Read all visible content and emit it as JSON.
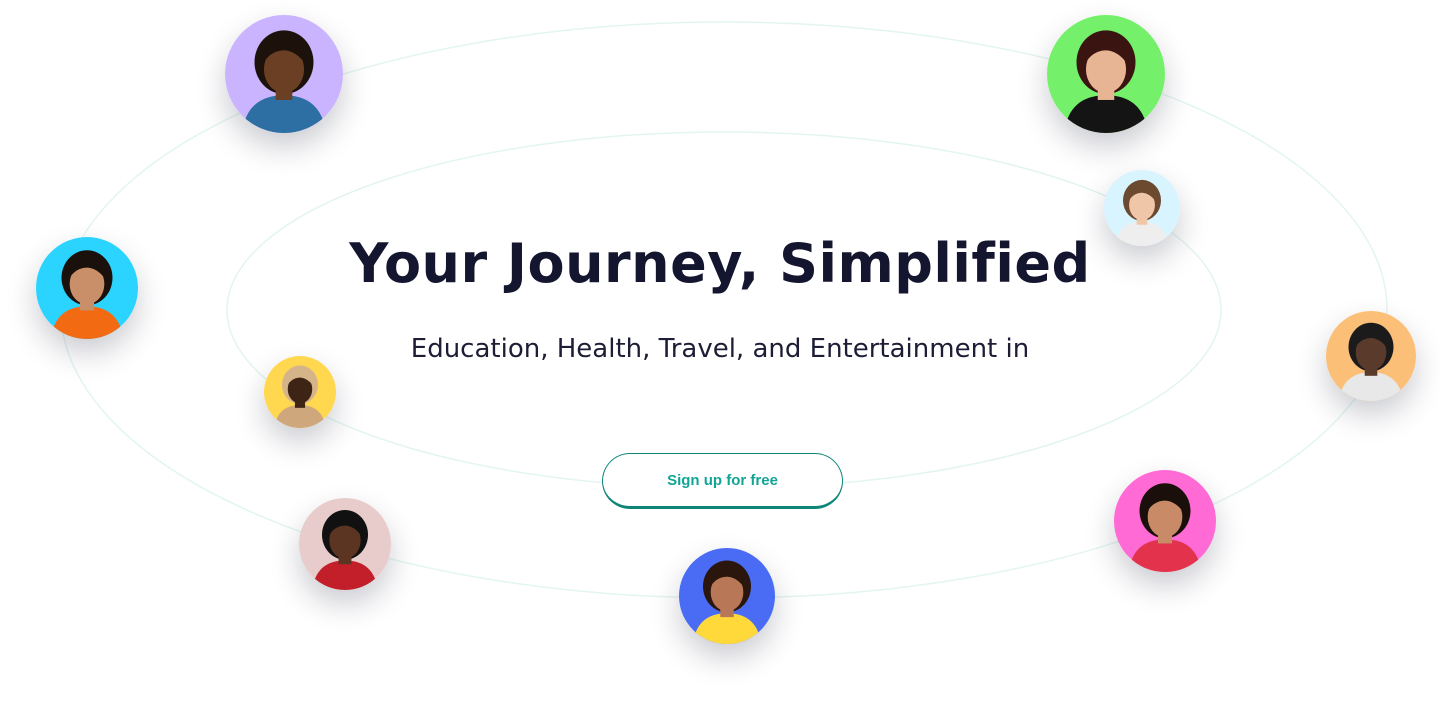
{
  "hero": {
    "title": "Your Journey, Simplified",
    "subtitle": "Education, Health, Travel, and Entertainment in",
    "cta_label": "Sign up for free"
  },
  "colors": {
    "accent_teal": "#12a596",
    "button_border": "#0f8578",
    "heading": "#14152e",
    "orbit_line": "#e3f5f1"
  },
  "avatars": [
    {
      "name": "avatar-purple",
      "bg": "#cbb4ff",
      "skin": "#6b3f24",
      "hair": "#1d120b",
      "shirt": "#2d6fa3"
    },
    {
      "name": "avatar-green",
      "bg": "#74f06a",
      "skin": "#e7b594",
      "hair": "#3a1410",
      "shirt": "#141414"
    },
    {
      "name": "avatar-light-blue",
      "bg": "#d8f4ff",
      "skin": "#efc7a8",
      "hair": "#6b4a30",
      "shirt": "#eeeeee"
    },
    {
      "name": "avatar-cyan",
      "bg": "#2ad4ff",
      "skin": "#c98f68",
      "hair": "#1a110c",
      "shirt": "#f26a12"
    },
    {
      "name": "avatar-orange",
      "bg": "#fbbf78",
      "skin": "#5a3a2a",
      "hair": "#1b1b1b",
      "shirt": "#e8e8e8"
    },
    {
      "name": "avatar-yellow",
      "bg": "#ffd84f",
      "skin": "#3e2414",
      "hair": "#d6b48a",
      "shirt": "#cfa77c"
    },
    {
      "name": "avatar-pink-gray",
      "bg": "#e8cccc",
      "skin": "#5c3522",
      "hair": "#111111",
      "shirt": "#c21f2a"
    },
    {
      "name": "avatar-magenta",
      "bg": "#ff6ad5",
      "skin": "#c88a67",
      "hair": "#1a0f0a",
      "shirt": "#e2324c"
    },
    {
      "name": "avatar-blue",
      "bg": "#4a6cf5",
      "skin": "#b87757",
      "hair": "#2a160c",
      "shirt": "#ffd83a"
    }
  ]
}
